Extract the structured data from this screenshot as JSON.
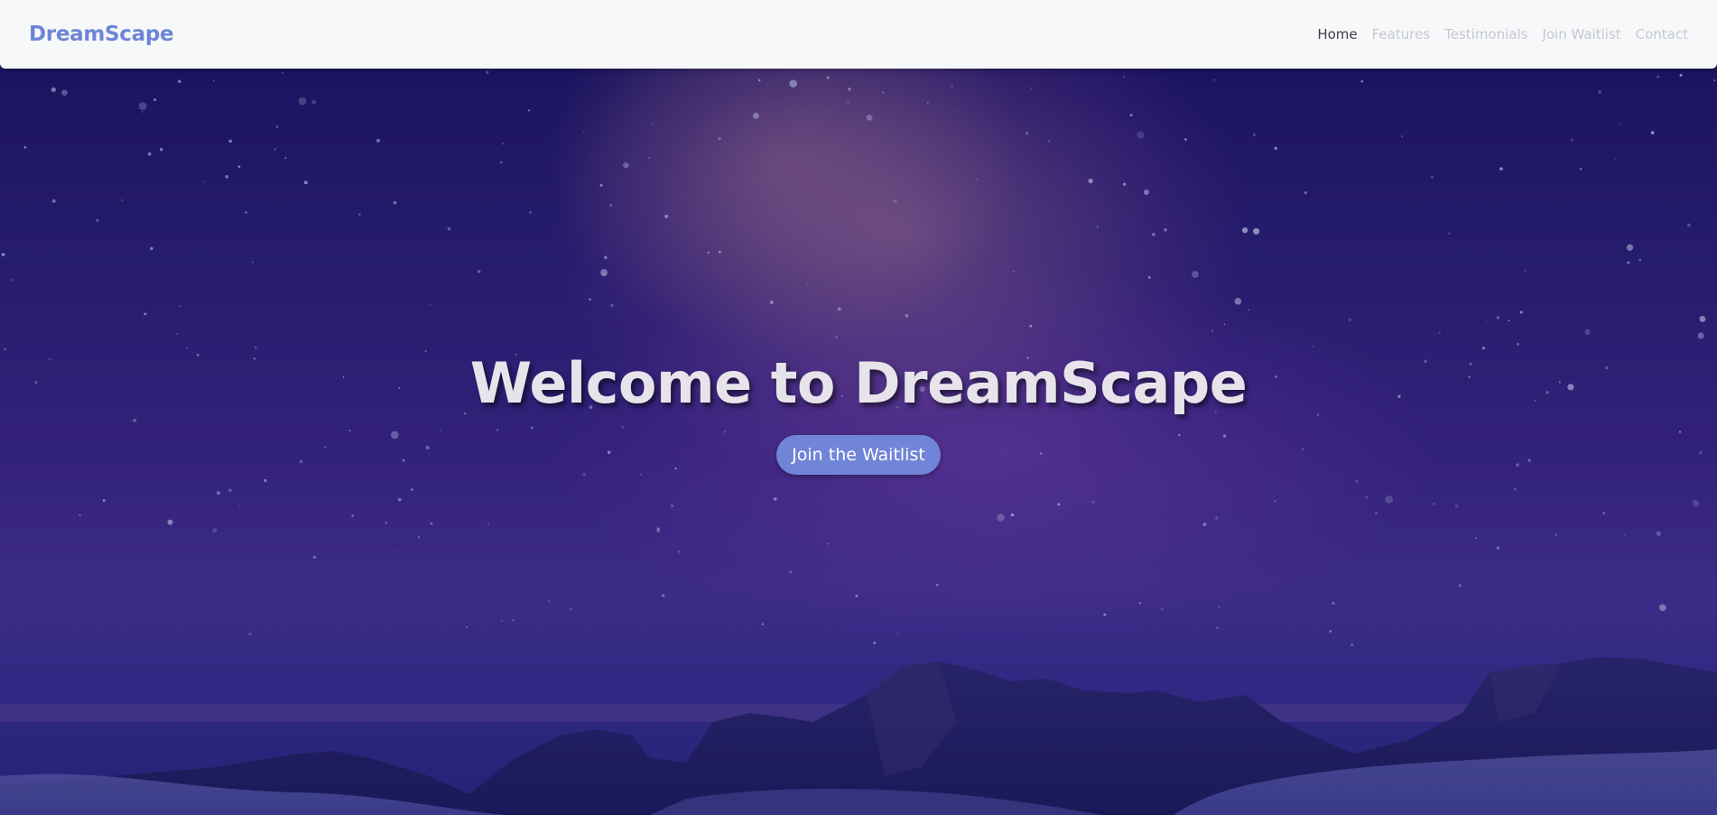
{
  "navbar": {
    "brand": "DreamScape",
    "links": [
      {
        "label": "Home",
        "active": true
      },
      {
        "label": "Features",
        "active": false
      },
      {
        "label": "Testimonials",
        "active": false
      },
      {
        "label": "Join Waitlist",
        "active": false
      },
      {
        "label": "Contact",
        "active": false
      }
    ]
  },
  "hero": {
    "title": "Welcome to DreamScape",
    "cta_label": "Join the Waitlist"
  },
  "colors": {
    "brand": "#6c85d6",
    "cta_background": "#7085d7",
    "navbar_background": "#f7f8fa",
    "hero_title": "#e6e4ea"
  }
}
